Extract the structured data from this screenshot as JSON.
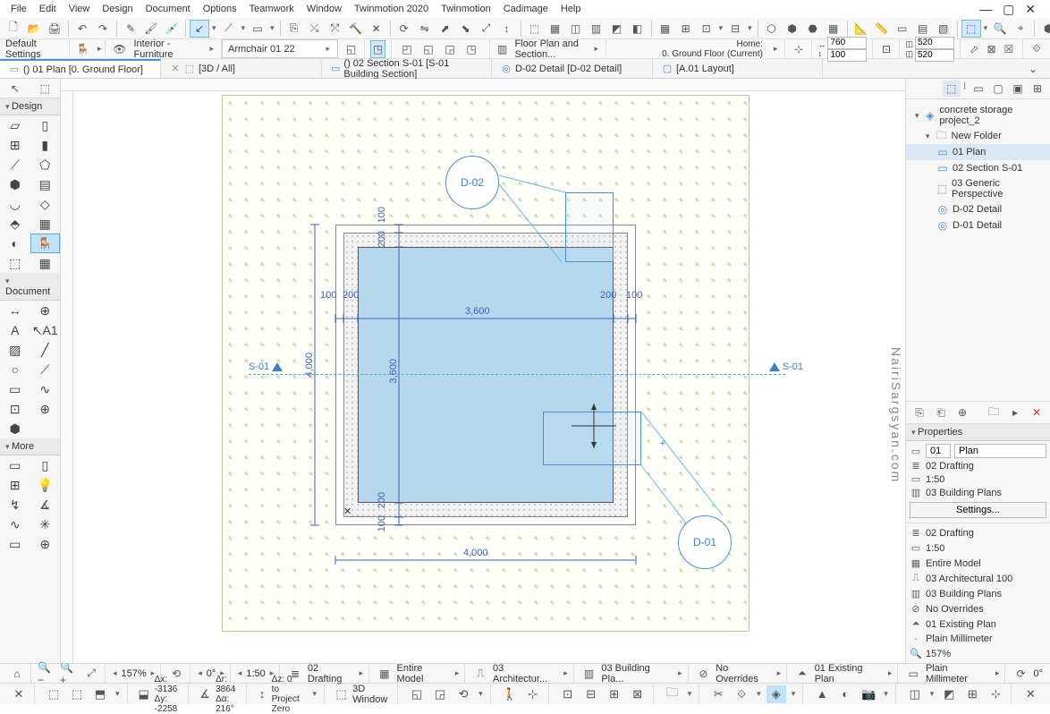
{
  "menu": [
    "File",
    "Edit",
    "View",
    "Design",
    "Document",
    "Options",
    "Teamwork",
    "Window",
    "Twinmotion 2020",
    "Twinmotion",
    "Cadimage",
    "Help"
  ],
  "infobar": {
    "default": "Default Settings",
    "layer": "Interior - Furniture",
    "object": "Armchair 01 22",
    "floorsect": "Floor Plan and Section...",
    "home_label": "Home:",
    "home_value": "0. Ground Floor (Current)",
    "w": "760",
    "h": "100",
    "w2": "520",
    "h2": "520"
  },
  "tabs": {
    "t1": "() 01 Plan [0. Ground Floor]",
    "t2": "[3D / All]",
    "t3": "() 02 Section S-01 [S-01 Building Section]",
    "t4": "D-02 Detail [D-02 Detail]",
    "t5": "[A.01 Layout]"
  },
  "toolgroups": {
    "g1": "Design",
    "g2": "Document",
    "g3": "More"
  },
  "drawing": {
    "w_total": "4,000",
    "h_total": "4,000",
    "inner_w": "3,600",
    "inner_h": "3,600",
    "t1": "100",
    "t2": "200",
    "s01": "S-01",
    "d01": "D-01",
    "d02": "D-02"
  },
  "tree": {
    "root": "concrete storage project_2",
    "folder": "New Folder",
    "items": [
      "01 Plan",
      "02 Section S-01",
      "03 Generic Perspective",
      "D-02 Detail",
      "D-01 Detail"
    ]
  },
  "props": {
    "title": "Properties",
    "id": "01",
    "name": "Plan",
    "r1": "02 Drafting",
    "r2": "1:50",
    "r3": "03 Building Plans",
    "settings": "Settings...",
    "list": [
      "02 Drafting",
      "1:50",
      "Entire Model",
      "03 Architectural 100",
      "03 Building Plans",
      "No Overrides",
      "01 Existing Plan",
      "Plain Millimeter",
      "157%"
    ]
  },
  "status1": {
    "zoom": "157%",
    "angle1": "0°",
    "angle2": "1:50",
    "s1": "02 Drafting",
    "s2": "Entire Model",
    "s3": "03 Architectur...",
    "s4": "03 Building Pla...",
    "s5": "No Overrides",
    "s6": "01 Existing Plan",
    "s7": "Plain Millimeter",
    "s8": "0°"
  },
  "status2": {
    "dx": "Δx: -3136",
    "dy": "Δy: -2258",
    "dr": "Δr: 3864",
    "da": "Δα: 216°",
    "dz": "Δz: 0",
    "pz": "to Project Zero",
    "win": "3D Window"
  },
  "watermark": "NairiSargsyan.com"
}
